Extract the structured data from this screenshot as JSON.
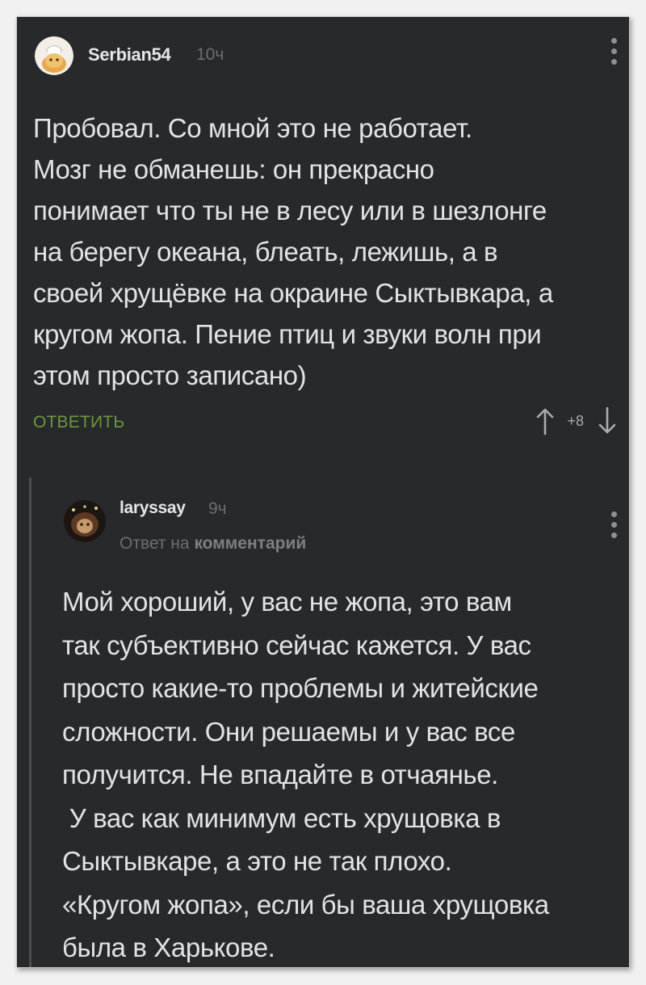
{
  "comment1": {
    "username": "Serbian54",
    "time": "10ч",
    "lines": [
      "Пробовал. Со мной это не работает.",
      "Мозг не обманешь: он прекрасно",
      "понимает что ты не в лесу или в шезлонге",
      "на берегу океана, блеать, лежишь, а в",
      "своей хрущёвке на окраине Сыктывкара, а",
      "кругом жопа. Пение птиц и звуки волн при",
      "этом просто записано)"
    ],
    "reply_label": "ОТВЕТИТЬ",
    "score": "+8"
  },
  "comment2": {
    "username": "laryssay",
    "time": "9ч",
    "reply_to_prefix": "Ответ на",
    "reply_to_target": "комментарий",
    "lines": [
      "Мой хороший, у вас не жопа, это вам",
      "так субъективно сейчас кажется. У вас",
      "просто какие-то проблемы и житейские",
      "сложности. Они решаемы и у вас все",
      "получится. Не впадайте в отчаянье.",
      " У вас как минимум есть хрущовка в",
      "Сыктывкаре, а это не так плохо.",
      "«Кругом жопа», если бы ваша хрущовка",
      "была в Харькове."
    ]
  },
  "colors": {
    "background": "#27292b",
    "text": "#e3e3e3",
    "muted": "#6c6f72",
    "reply_green": "#6a9a3a"
  },
  "icons": {
    "avatar1": "avatar-cartoon",
    "avatar2": "avatar-photo",
    "more": "more-vertical-icon",
    "upvote": "arrow-up-icon",
    "downvote": "arrow-down-icon"
  }
}
